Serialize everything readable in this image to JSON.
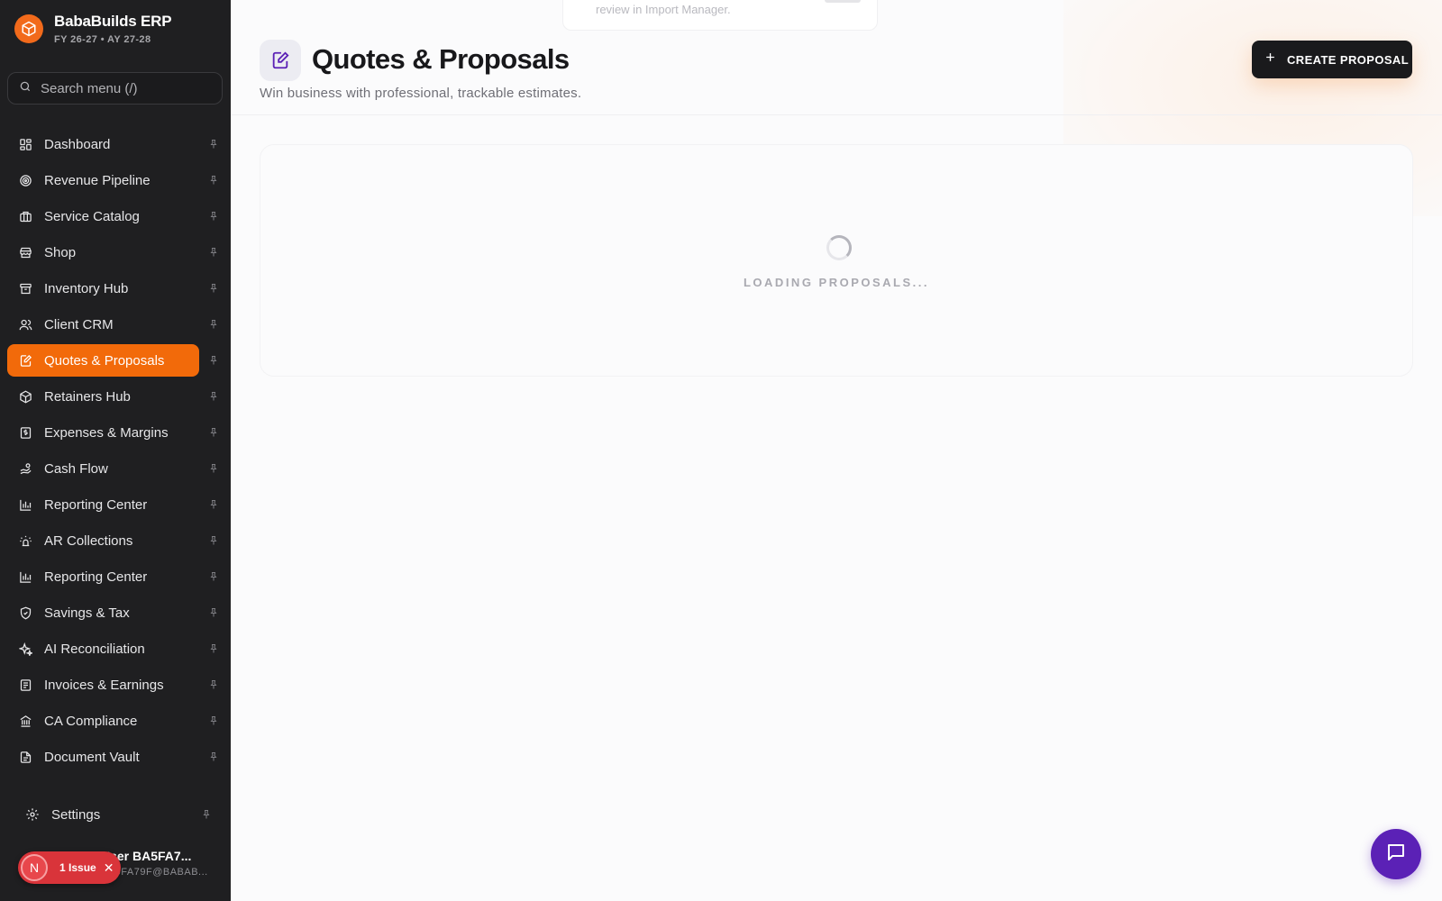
{
  "brand": {
    "title": "BabaBuilds ERP",
    "subtitle": "FY 26-27 • AY 27-28"
  },
  "search": {
    "placeholder": "Search menu (/)"
  },
  "nav": {
    "items": [
      {
        "label": "Dashboard",
        "icon": "dashboard-icon"
      },
      {
        "label": "Revenue Pipeline",
        "icon": "target-icon"
      },
      {
        "label": "Service Catalog",
        "icon": "briefcase-icon"
      },
      {
        "label": "Shop",
        "icon": "store-icon"
      },
      {
        "label": "Inventory Hub",
        "icon": "archive-icon"
      },
      {
        "label": "Client CRM",
        "icon": "users-icon"
      },
      {
        "label": "Quotes & Proposals",
        "icon": "edit-document-icon",
        "active": true
      },
      {
        "label": "Retainers Hub",
        "icon": "package-icon"
      },
      {
        "label": "Expenses & Margins",
        "icon": "receipt-icon"
      },
      {
        "label": "Cash Flow",
        "icon": "hand-coins-icon"
      },
      {
        "label": "Reporting Center",
        "icon": "bar-chart-icon"
      },
      {
        "label": "AR Collections",
        "icon": "alarm-icon"
      },
      {
        "label": "Reporting Center",
        "icon": "bar-chart-icon"
      },
      {
        "label": "Savings & Tax",
        "icon": "shield-icon"
      },
      {
        "label": "AI Reconciliation",
        "icon": "sparkles-icon"
      },
      {
        "label": "Invoices & Earnings",
        "icon": "invoice-icon"
      },
      {
        "label": "CA Compliance",
        "icon": "bank-icon"
      },
      {
        "label": "Document Vault",
        "icon": "file-icon"
      }
    ],
    "settings": "Settings"
  },
  "user": {
    "name": "User BA5FA7...",
    "email": "BA5FA79F@BABAB...",
    "issue_badge": "1 Issue",
    "issue_avatar": "N"
  },
  "toast": {
    "text": "review in Import Manager."
  },
  "page": {
    "title": "Quotes & Proposals",
    "subtitle": "Win business with professional, trackable estimates.",
    "create_label": "CREATE PROPOSAL",
    "loading_text": "LOADING PROPOSALS..."
  },
  "colors": {
    "sidebar_bg": "#1f1f21",
    "accent": "#f26a0a",
    "chat_button": "#5b21b6",
    "create_button": "#1a1a1c"
  }
}
